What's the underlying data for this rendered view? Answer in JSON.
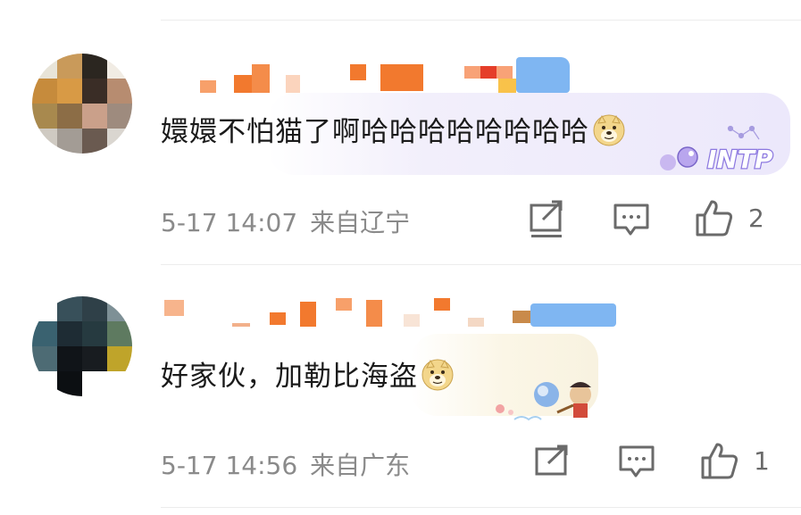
{
  "comments": [
    {
      "text": "嬛嬛不怕猫了啊哈哈哈哈哈哈哈哈",
      "time": "5-17 14:07",
      "location": "来自辽宁",
      "likes": "2",
      "badge_text": "INTP"
    },
    {
      "text": "好家伙，加勒比海盗",
      "time": "5-17 14:56",
      "location": "来自广东",
      "likes": "1"
    }
  ],
  "icons": {
    "repost": "repost-icon",
    "comment": "comment-icon",
    "like": "like-icon",
    "emoji": "doge-emoji-icon"
  },
  "colors": {
    "mosaic_orange": "#f2792e",
    "meta_gray": "#8a8a8a",
    "icon_gray": "#6a6a6a"
  }
}
